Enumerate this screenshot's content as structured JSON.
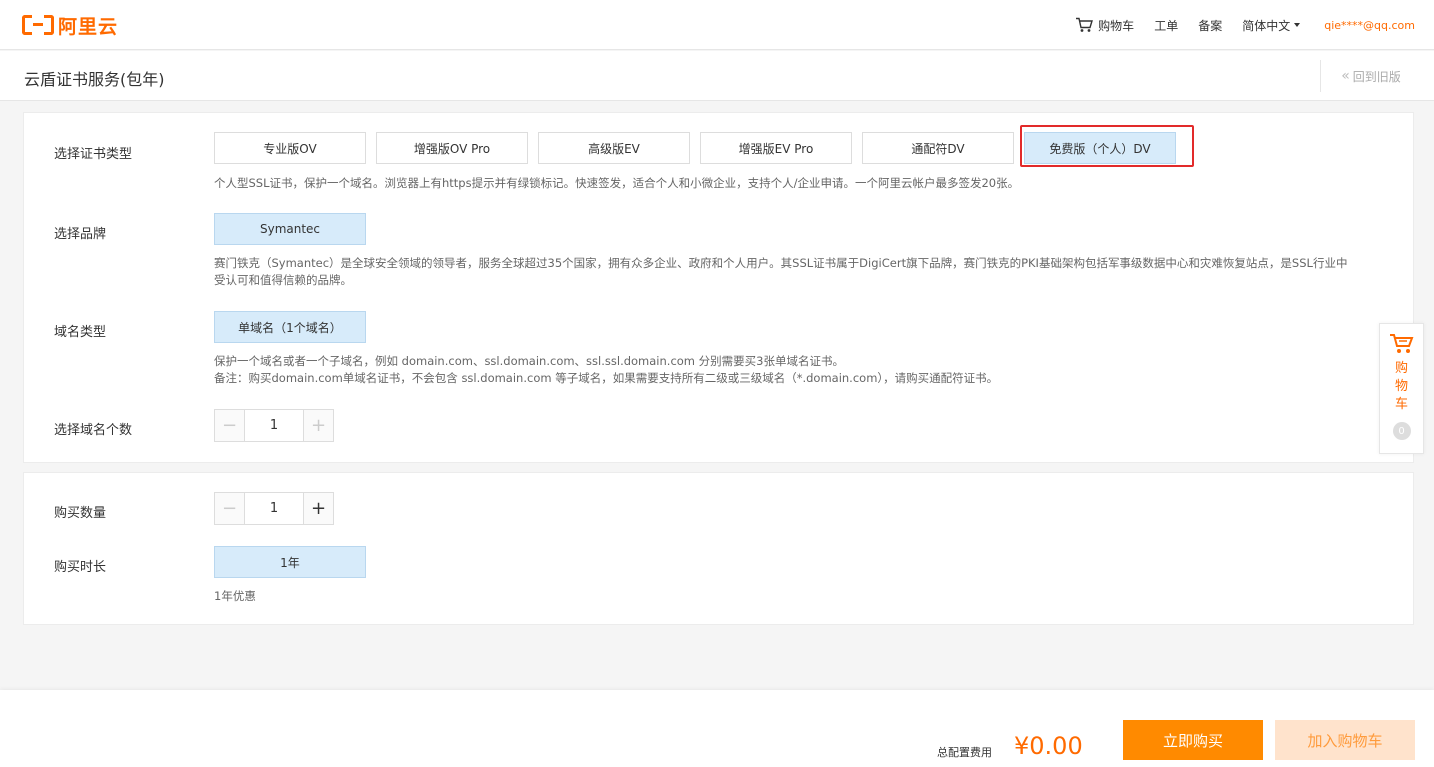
{
  "header": {
    "logo_text": "阿里云",
    "nav": {
      "cart": "购物车",
      "ticket": "工单",
      "filing": "备案",
      "language": "简体中文",
      "user": "qie****@qq.com"
    }
  },
  "page": {
    "title": "云盾证书服务(包年)",
    "back_old": "回到旧版"
  },
  "cert_type": {
    "label": "选择证书类型",
    "options": [
      "专业版OV",
      "增强版OV Pro",
      "高级版EV",
      "增强版EV Pro",
      "通配符DV",
      "免费版（个人）DV"
    ],
    "selected_index": 5,
    "description": "个人型SSL证书，保护一个域名。浏览器上有https提示并有绿锁标记。快速签发，适合个人和小微企业，支持个人/企业申请。一个阿里云帐户最多签发20张。"
  },
  "brand": {
    "label": "选择品牌",
    "option": "Symantec",
    "description_line1": "赛门铁克（Symantec）是全球安全领域的领导者，服务全球超过35个国家，拥有众多企业、政府和个人用户。其SSL证书属于DigiCert旗下品牌，赛门铁克的PKI基础架构包括军事级数据中心和灾难恢复站点，是SSL行业中",
    "description_line2": "受认可和值得信赖的品牌。"
  },
  "domain_type": {
    "label": "域名类型",
    "option": "单域名（1个域名）",
    "description_line1": "保护一个域名或者一个子域名，例如 domain.com、ssl.domain.com、ssl.ssl.domain.com 分别需要买3张单域名证书。",
    "description_line2": "备注：购买domain.com单域名证书，不会包含 ssl.domain.com 等子域名，如果需要支持所有二级或三级域名（*.domain.com），请购买通配符证书。"
  },
  "domain_count": {
    "label": "选择域名个数",
    "value": "1",
    "minus": "−",
    "plus": "+"
  },
  "quantity": {
    "label": "购买数量",
    "value": "1",
    "minus": "−",
    "plus": "+"
  },
  "duration": {
    "label": "购买时长",
    "option": "1年",
    "note": "1年优惠"
  },
  "float_cart": {
    "text": "购物车",
    "count": "0"
  },
  "footer": {
    "total_label": "总配置费用",
    "total_price": "¥0.00",
    "buy_now": "立即购买",
    "add_to_cart": "加入购物车"
  },
  "colors": {
    "brand": "#ff6a00",
    "selected_bg": "#d7ebfa",
    "highlight": "#e22a2a",
    "buy_button": "#ff8a00",
    "cart_button_bg": "#ffe3cc"
  }
}
